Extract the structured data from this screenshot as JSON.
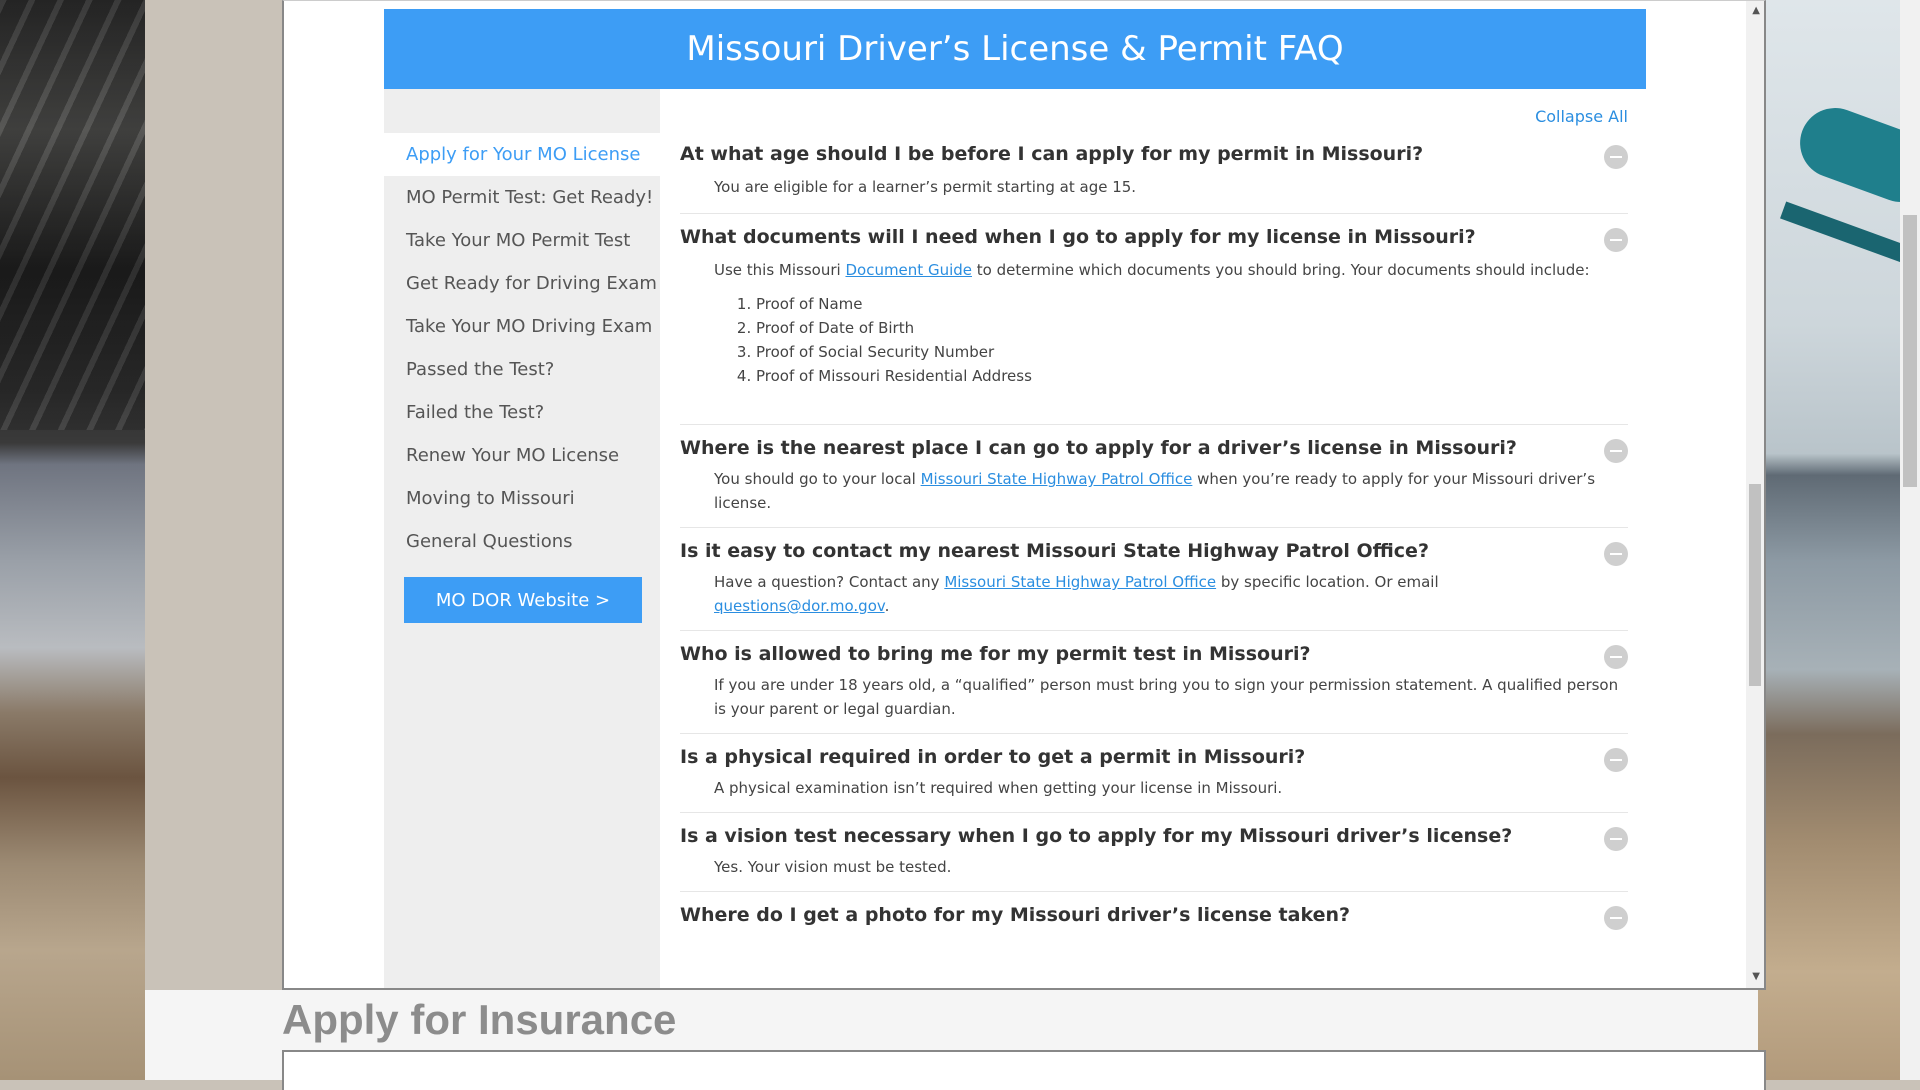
{
  "page": {
    "title": "Missouri Driver’s License & Permit FAQ",
    "collapse_all": "Collapse All",
    "insurance_title": "Apply for Insurance"
  },
  "sidebar": {
    "items": [
      {
        "label": "Apply for Your MO License",
        "active": true
      },
      {
        "label": "MO Permit Test: Get Ready!"
      },
      {
        "label": "Take Your MO Permit Test"
      },
      {
        "label": "Get Ready for Driving Exam"
      },
      {
        "label": "Take Your MO Driving Exam"
      },
      {
        "label": "Passed the Test?"
      },
      {
        "label": "Failed the Test?"
      },
      {
        "label": "Renew Your MO License"
      },
      {
        "label": "Moving to Missouri"
      },
      {
        "label": "General Questions"
      }
    ],
    "button": "MO DOR Website >"
  },
  "faqs": {
    "q1": {
      "question": "At what age should I be before I can apply for my permit in Missouri?",
      "answer": "You are eligible for a learner’s permit starting at age 15."
    },
    "q2": {
      "question": "What documents will I need when I go to apply for my license in Missouri?",
      "answer_pre": "Use this Missouri ",
      "answer_link": "Document Guide",
      "answer_post": " to determine which documents you should bring. Your documents should include:",
      "list": [
        "Proof of Name",
        "Proof of Date of Birth",
        "Proof of Social Security Number",
        "Proof of Missouri Residential Address"
      ]
    },
    "q3": {
      "question": "Where is the nearest place I can go to apply for a driver’s license in Missouri?",
      "answer_pre": "You should go to your local ",
      "answer_link": "Missouri State Highway Patrol Office",
      "answer_post": " when you’re ready to apply for your Missouri driver’s license."
    },
    "q4": {
      "question": "Is it easy to contact my nearest Missouri State Highway Patrol Office?",
      "answer_pre": "Have a question? Contact any ",
      "answer_link": "Missouri State Highway Patrol Office",
      "answer_mid": " by specific location. Or email ",
      "answer_email": "questions@dor.mo.gov",
      "answer_post": "."
    },
    "q5": {
      "question": "Who is allowed to bring me for my permit test in Missouri?",
      "answer": "If you are under 18 years old, a “qualified” person must bring you to sign your permission statement. A qualified person is your parent or legal guardian."
    },
    "q6": {
      "question": "Is a physical required in order to get a permit in Missouri?",
      "answer": "A physical examination isn’t required when getting your license in Missouri."
    },
    "q7": {
      "question": "Is a vision test necessary when I go to apply for my Missouri driver’s license?",
      "answer": "Yes. Your vision must be tested."
    },
    "q8": {
      "question": "Where do I get a photo for my Missouri driver’s license taken?"
    }
  }
}
